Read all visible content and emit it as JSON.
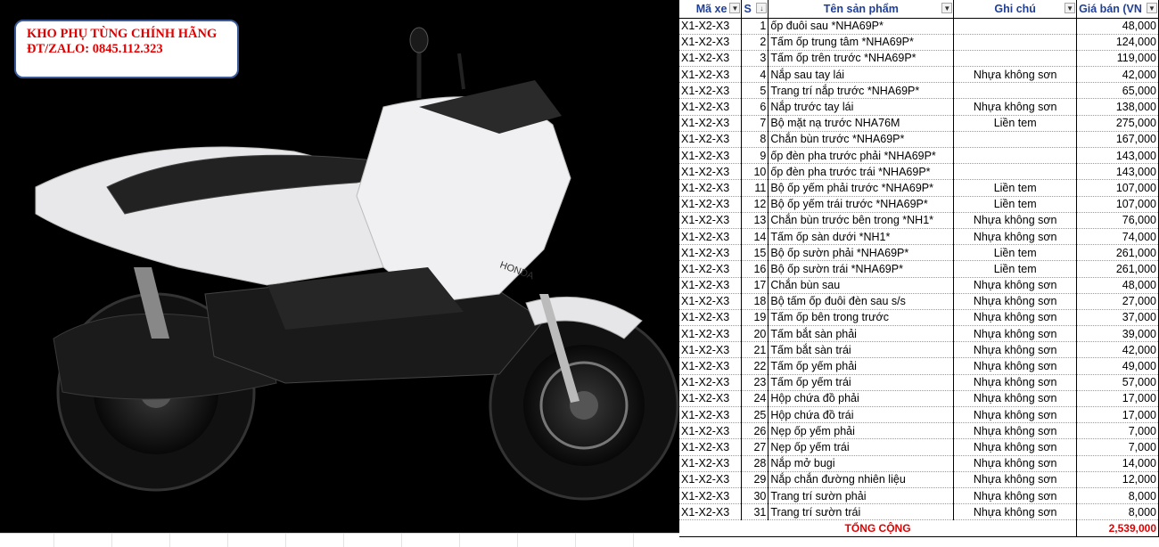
{
  "banner": {
    "line1": "KHO PHỤ TÙNG CHÍNH HÃNG",
    "line2": "ĐT/ZALO: 0845.112.323"
  },
  "bike": {
    "badge": "HONDA"
  },
  "sheet": {
    "headers": {
      "ma_xe": "Mã xe",
      "stt": "S",
      "ten_sp": "Tên sản phẩm",
      "ghi_chu": "Ghi chú",
      "gia_ban": "Giá bán (VN"
    },
    "rows": [
      {
        "ma": "X1-X2-X3",
        "stt": "1",
        "ten": "ốp đuôi sau *NHA69P*",
        "ghi": "",
        "gia": "48,000"
      },
      {
        "ma": "X1-X2-X3",
        "stt": "2",
        "ten": "Tấm ốp trung tâm *NHA69P*",
        "ghi": "",
        "gia": "124,000"
      },
      {
        "ma": "X1-X2-X3",
        "stt": "3",
        "ten": "Tấm ốp trên trước *NHA69P*",
        "ghi": "",
        "gia": "119,000"
      },
      {
        "ma": "X1-X2-X3",
        "stt": "4",
        "ten": "Nắp sau tay lái",
        "ghi": "Nhựa không sơn",
        "gia": "42,000"
      },
      {
        "ma": "X1-X2-X3",
        "stt": "5",
        "ten": "Trang trí nắp trước *NHA69P*",
        "ghi": "",
        "gia": "65,000"
      },
      {
        "ma": "X1-X2-X3",
        "stt": "6",
        "ten": "Nắp trước tay lái",
        "ghi": "Nhựa không sơn",
        "gia": "138,000"
      },
      {
        "ma": "X1-X2-X3",
        "stt": "7",
        "ten": "Bộ mặt nạ trước NHA76M",
        "ghi": "Liền tem",
        "gia": "275,000"
      },
      {
        "ma": "X1-X2-X3",
        "stt": "8",
        "ten": "Chắn bùn trước *NHA69P*",
        "ghi": "",
        "gia": "167,000"
      },
      {
        "ma": "X1-X2-X3",
        "stt": "9",
        "ten": "ốp đèn pha trước phải *NHA69P*",
        "ghi": "",
        "gia": "143,000"
      },
      {
        "ma": "X1-X2-X3",
        "stt": "10",
        "ten": "ốp đèn pha trước trái *NHA69P*",
        "ghi": "",
        "gia": "143,000"
      },
      {
        "ma": "X1-X2-X3",
        "stt": "11",
        "ten": "Bộ ốp yếm phải trước *NHA69P*",
        "ghi": "Liền tem",
        "gia": "107,000"
      },
      {
        "ma": "X1-X2-X3",
        "stt": "12",
        "ten": "Bộ ốp yếm trái trước *NHA69P*",
        "ghi": "Liền tem",
        "gia": "107,000"
      },
      {
        "ma": "X1-X2-X3",
        "stt": "13",
        "ten": "Chắn bùn trước bên trong *NH1*",
        "ghi": "Nhựa không sơn",
        "gia": "76,000"
      },
      {
        "ma": "X1-X2-X3",
        "stt": "14",
        "ten": "Tấm ốp sàn dưới *NH1*",
        "ghi": "Nhựa không sơn",
        "gia": "74,000"
      },
      {
        "ma": "X1-X2-X3",
        "stt": "15",
        "ten": "Bộ ốp sườn phải *NHA69P*",
        "ghi": "Liền tem",
        "gia": "261,000"
      },
      {
        "ma": "X1-X2-X3",
        "stt": "16",
        "ten": "Bộ ốp sườn trái *NHA69P*",
        "ghi": "Liền tem",
        "gia": "261,000"
      },
      {
        "ma": "X1-X2-X3",
        "stt": "17",
        "ten": "Chắn bùn sau",
        "ghi": "Nhựa không sơn",
        "gia": "48,000"
      },
      {
        "ma": "X1-X2-X3",
        "stt": "18",
        "ten": "Bộ tấm ốp đuôi đèn sau s/s",
        "ghi": "Nhựa không sơn",
        "gia": "27,000"
      },
      {
        "ma": "X1-X2-X3",
        "stt": "19",
        "ten": "Tấm ốp bên trong trước",
        "ghi": "Nhựa không sơn",
        "gia": "37,000"
      },
      {
        "ma": "X1-X2-X3",
        "stt": "20",
        "ten": "Tấm bắt sàn phải",
        "ghi": "Nhựa không sơn",
        "gia": "39,000"
      },
      {
        "ma": "X1-X2-X3",
        "stt": "21",
        "ten": "Tấm bắt sàn trái",
        "ghi": "Nhựa không sơn",
        "gia": "42,000"
      },
      {
        "ma": "X1-X2-X3",
        "stt": "22",
        "ten": "Tấm ốp yếm phải",
        "ghi": "Nhựa không sơn",
        "gia": "49,000"
      },
      {
        "ma": "X1-X2-X3",
        "stt": "23",
        "ten": "Tấm ốp yếm trái",
        "ghi": "Nhựa không sơn",
        "gia": "57,000"
      },
      {
        "ma": "X1-X2-X3",
        "stt": "24",
        "ten": "Hộp chứa đồ phải",
        "ghi": "Nhựa không sơn",
        "gia": "17,000"
      },
      {
        "ma": "X1-X2-X3",
        "stt": "25",
        "ten": "Hộp chứa đồ trái",
        "ghi": "Nhựa không sơn",
        "gia": "17,000"
      },
      {
        "ma": "X1-X2-X3",
        "stt": "26",
        "ten": "Nẹp ốp yếm phải",
        "ghi": "Nhựa không sơn",
        "gia": "7,000"
      },
      {
        "ma": "X1-X2-X3",
        "stt": "27",
        "ten": "Nẹp ốp yếm trái",
        "ghi": "Nhựa không sơn",
        "gia": "7,000"
      },
      {
        "ma": "X1-X2-X3",
        "stt": "28",
        "ten": "Nắp mở bugi",
        "ghi": "Nhựa không sơn",
        "gia": "14,000"
      },
      {
        "ma": "X1-X2-X3",
        "stt": "29",
        "ten": "Nắp chắn đường nhiên liệu",
        "ghi": "Nhựa không sơn",
        "gia": "12,000"
      },
      {
        "ma": "X1-X2-X3",
        "stt": "30",
        "ten": "Trang trí sườn phải",
        "ghi": "Nhựa không sơn",
        "gia": "8,000"
      },
      {
        "ma": "X1-X2-X3",
        "stt": "31",
        "ten": "Trang trí sườn trái",
        "ghi": "Nhựa không sơn",
        "gia": "8,000"
      }
    ],
    "total_label": "TỔNG CỘNG",
    "total_value": "2,539,000"
  },
  "colors": {
    "header_text": "#1f3f99",
    "banner_text": "#e00000",
    "total_text": "#e00000"
  },
  "icons": {
    "filter": "filter-dropdown-icon",
    "sort": "sort-filter-icon"
  }
}
